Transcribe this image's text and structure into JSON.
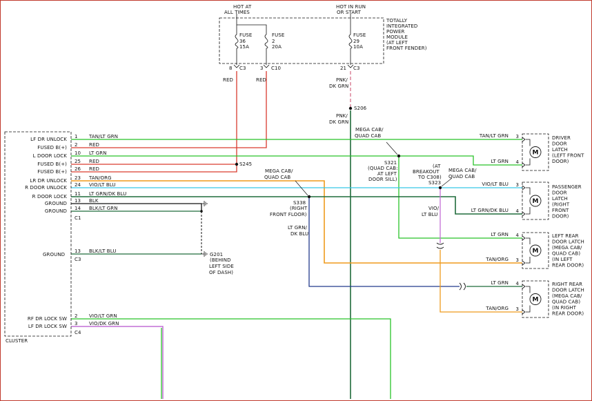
{
  "colors": {
    "red": "#d93a2e",
    "green": "#28c228",
    "dark_green": "#1f6b3a",
    "orange": "#ef9a1c",
    "cyan": "#36c8e8",
    "navy": "#223a8c",
    "violet": "#c26ed6",
    "pink": "#d6708a",
    "black": "#111111"
  },
  "top": {
    "hot_at": "HOT AT",
    "all_times": "ALL TIMES",
    "hot_in": "HOT IN RUN",
    "or_start": "OR START",
    "tipm": [
      "TOTALLY",
      "INTEGRATED",
      "POWER",
      "MODULE",
      "(AT LEFT",
      "FRONT FENDER)"
    ],
    "fuse_label": "FUSE",
    "fuse_36": [
      "36",
      "15A"
    ],
    "fuse_2": [
      "2",
      "20A"
    ],
    "fuse_29": [
      "29",
      "10A"
    ],
    "pin_8": "8",
    "c3": "C3",
    "pin_3": "3",
    "c10": "C10",
    "pin_21": "21",
    "red": "RED",
    "pnk1": "PNK/",
    "dkgrn1": "DK GRN",
    "s206": "S206",
    "pnk2": "PNK/",
    "dkgrn2": "DK GRN"
  },
  "cluster": {
    "name": "CLUSTER",
    "rows": [
      {
        "label": "LF DR UNLOCK",
        "pin": "1",
        "wire": "TAN/LT GRN"
      },
      {
        "label": "FUSED B(+)",
        "pin": "2",
        "wire": "RED"
      },
      {
        "label": "L DOOR LOCK",
        "pin": "10",
        "wire": "LT GRN"
      },
      {
        "label": "FUSED B(+)",
        "pin": "25",
        "wire": "RED"
      },
      {
        "label": "FUSED B(+)",
        "pin": "26",
        "wire": "RED"
      },
      {
        "label": "LR DR UNLOCK",
        "pin": "23",
        "wire": "TAN/ORG"
      },
      {
        "label": "R DOOR UNLOCK",
        "pin": "24",
        "wire": "VIO/LT BLU"
      },
      {
        "label": "R DOOR LOCK",
        "pin": "11",
        "wire": "LT GRN/DK BLU"
      },
      {
        "label": "GROUND",
        "pin": "13",
        "wire": "BLK"
      },
      {
        "label": "GROUND",
        "pin": "14",
        "wire": "BLK/LT GRN"
      }
    ],
    "c1": "C1",
    "ground_c3": {
      "label": "GROUND",
      "pin": "13",
      "wire": "BLK/LT BLU",
      "conn": "C3"
    },
    "bottom_rows": [
      {
        "label": "RF DR LOCK SW",
        "pin": "2",
        "wire": "VIO/LT GRN"
      },
      {
        "label": "LF DR LOCK SW",
        "pin": "3",
        "wire": "VIO/DK GRN"
      }
    ],
    "c4": "C4"
  },
  "splices": {
    "s245": "S245",
    "s321": [
      "S321",
      "(QUAD CAB:",
      "AT LEFT",
      "DOOR SILL)"
    ],
    "mega1": [
      "MEGA CAB/",
      "QUAD CAB"
    ],
    "mega2": [
      "MEGA CAB/",
      "QUAD CAB"
    ],
    "mega3": [
      "MEGA CAB/",
      "QUAD CAB"
    ],
    "s338": [
      "S338",
      "(RIGHT",
      "FRONT FLOOR)"
    ],
    "s323": [
      "(AT",
      "BREAKOUT",
      "TO C308)",
      "S323"
    ],
    "g201": [
      "G201",
      "(BEHIND",
      "LEFT SIDE",
      "OF DASH)"
    ],
    "ltgrn_dkblu": [
      "LT GRN/",
      "DK BLU"
    ],
    "vio_ltblu": [
      "VIO/",
      "LT BLU"
    ]
  },
  "right": {
    "driver": {
      "name": [
        "DRIVER",
        "DOOR",
        "LATCH",
        "(LEFT FRONT",
        "DOOR)"
      ],
      "w1": "TAN/LT GRN",
      "p1": "3",
      "w2": "LT GRN",
      "p2": "4"
    },
    "passenger": {
      "name": [
        "PASSENGER",
        "DOOR",
        "LATCH",
        "(RIGHT",
        "FRONT",
        "DOOR)"
      ],
      "w1": "VIO/LT BLU",
      "p1": "3",
      "w2": "LT GRN/DK BLU",
      "p2": "4"
    },
    "left_rear": {
      "name": [
        "LEFT REAR",
        "DOOR LATCH",
        "(MEGA CAB/",
        "QUAD CAB)",
        "(IN LEFT",
        "REAR DOOR)"
      ],
      "w1": "LT GRN",
      "p1": "4",
      "w2": "TAN/ORG",
      "p2": "3"
    },
    "right_rear": {
      "name": [
        "RIGHT REAR",
        "DOOR LATCH",
        "(MEGA CAB/",
        "QUAD CAB)",
        "(IN RIGHT",
        "REAR DOOR)"
      ],
      "w1": "LT GRN",
      "p1": "4",
      "w2": "TAN/ORG",
      "p2": "3"
    },
    "motor": "M"
  }
}
